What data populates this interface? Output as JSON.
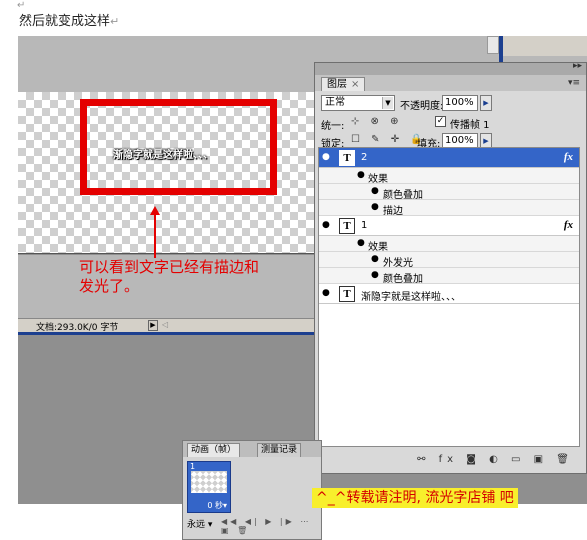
{
  "doc": {
    "top_mark": "↵",
    "caption": "然后就变成这样",
    "caption_mark": "↵"
  },
  "canvas": {
    "text": "渐隐字就是这样啦、、、"
  },
  "annotation": {
    "line1": "可以看到文字已经有描边和",
    "line2": "发光了。"
  },
  "statusbar": {
    "info": "文档:293.0K/0 字节",
    "arrow": "▶",
    "scroll": "◁"
  },
  "layers_panel": {
    "titlebar_icon": "▸▸",
    "tab_label": "图层",
    "tab_close": "×",
    "menu_icon": "▾≡",
    "blend_mode": "正常",
    "dropdown_arrow": "▼",
    "opacity_label": "不透明度:",
    "opacity_value": "100%",
    "opacity_arrow": "▶",
    "unify_label": "统一:",
    "unify_icons": "⊹ ⊗ ⊕",
    "propagate_check": "✓",
    "propagate_label": "传播帧 1",
    "lock_label": "锁定:",
    "lock_icons": "☐ ✎ ✛ 🔒",
    "fill_label": "填充:",
    "fill_value": "100%",
    "fill_arrow": "▶",
    "eye": "●",
    "t_glyph": "T",
    "fx": "fx",
    "layers": [
      {
        "name": "2",
        "effects_label": "效果",
        "effects": [
          "颜色叠加",
          "描边"
        ]
      },
      {
        "name": "1",
        "effects_label": "效果",
        "effects": [
          "外发光",
          "颜色叠加"
        ]
      },
      {
        "name": "渐隐字就是这样啦、、、"
      }
    ],
    "bottom_icons": "⚯ fx ◙ ◐ ▭ ▣ 🗑"
  },
  "animation_panel": {
    "tab_active": "动画（帧）",
    "tab_inactive": "测量记录",
    "frame_number": "1",
    "frame_delay": "0 秒▾",
    "loop": "永远 ▾",
    "controls": "◀◀ ◀| ▶ |▶ ⋯ ▣ 🗑"
  },
  "watermark": "^_^转载请注明, 流光字店铺 吧"
}
